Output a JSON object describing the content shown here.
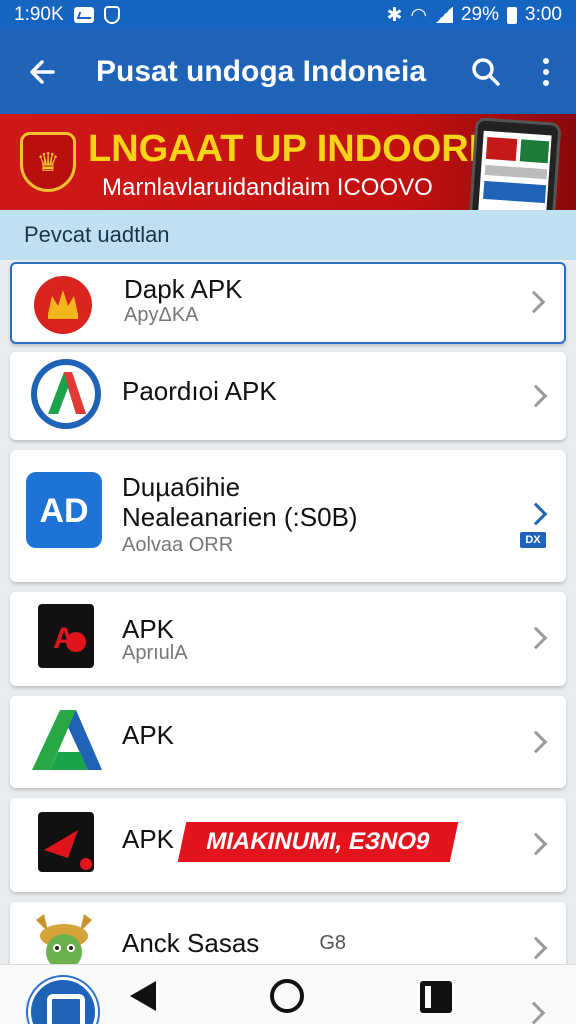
{
  "status_bar": {
    "time_left": "1:90K",
    "battery": "29%",
    "time_right": "3:00"
  },
  "app_bar": {
    "title": "Pusat undoga Indoneia"
  },
  "banner": {
    "title": "LNGAAT UP INDOORISIA",
    "subtitle": "Marnlavlaruidandiaim ICOOVO"
  },
  "section": {
    "header": "Pevcat uadtlan"
  },
  "apps": [
    {
      "name": "Dapk APK",
      "subtitle": "ApyΔKA"
    },
    {
      "name": "Paordıoi APK",
      "subtitle": ""
    },
    {
      "name_line1": "Duµaбihie",
      "name_line2": "Nealeanarien (:S0B)",
      "subtitle": "Aolvaa ORR",
      "badge": "DX"
    },
    {
      "name": "APK",
      "subtitle": "AprıulA"
    },
    {
      "name": "APK",
      "subtitle": ""
    },
    {
      "name": "APK",
      "promo": "MIAKINUMI, ЕЗNO9",
      "icon_label": "NEOCHAT"
    },
    {
      "name": "Anck Sasas",
      "tag": "G8"
    }
  ],
  "colors": {
    "primary": "#1e63b8",
    "banner_red": "#d01818",
    "banner_yellow": "#f7d417",
    "section_bg": "#bfe0f0",
    "promo_red": "#e3141e"
  }
}
